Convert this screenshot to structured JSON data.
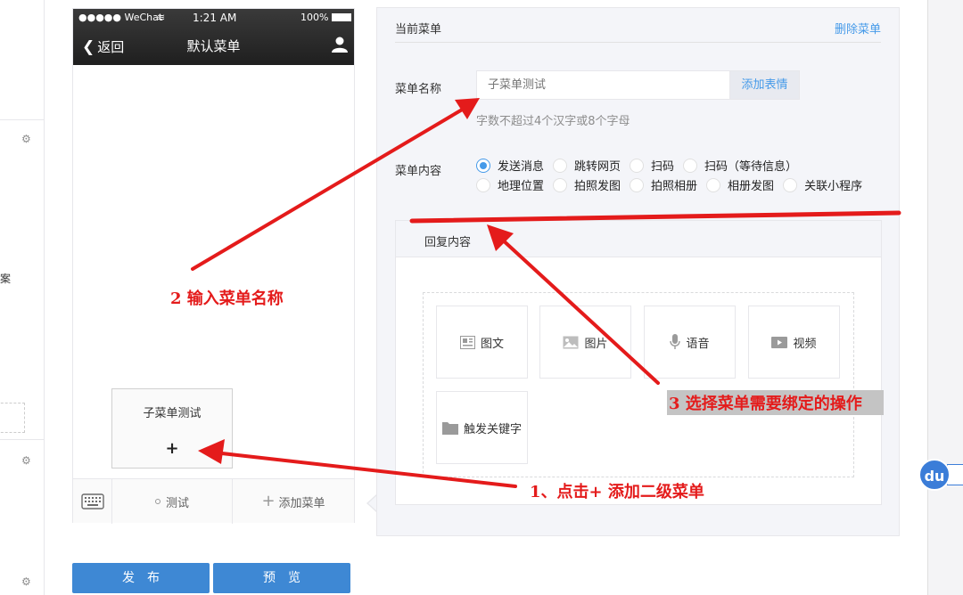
{
  "left_strip": {
    "cut_char": "案"
  },
  "phone": {
    "status_carrier": "●●●●● WeChat",
    "status_time": "1:21 AM",
    "status_battery": "100%",
    "back_label": "返回",
    "title": "默认菜单",
    "submenu_name": "子菜单测试",
    "submenu_add": "+",
    "bottom_menu": [
      {
        "label": "测试"
      },
      {
        "label": "添加菜单"
      }
    ]
  },
  "editor": {
    "title": "当前菜单",
    "delete_label": "删除菜单",
    "name_label": "菜单名称",
    "name_value": "子菜单测试",
    "emoji_button": "添加表情",
    "hint": "字数不超过4个汉字或8个字母",
    "content_label": "菜单内容",
    "options_row1": [
      {
        "label": "发送消息",
        "selected": true
      },
      {
        "label": "跳转网页",
        "selected": false
      },
      {
        "label": "扫码",
        "selected": false
      },
      {
        "label": "扫码（等待信息）",
        "selected": false
      }
    ],
    "options_row2": [
      {
        "label": "地理位置",
        "selected": false
      },
      {
        "label": "拍照发图",
        "selected": false
      },
      {
        "label": "拍照相册",
        "selected": false
      },
      {
        "label": "相册发图",
        "selected": false
      },
      {
        "label": "关联小程序",
        "selected": false
      }
    ],
    "reply_tab": "回复内容",
    "tiles": [
      {
        "label": "图文",
        "icon": "news-icon"
      },
      {
        "label": "图片",
        "icon": "image-icon"
      },
      {
        "label": "语音",
        "icon": "microphone-icon"
      },
      {
        "label": "视频",
        "icon": "video-icon"
      },
      {
        "label": "触发关键字",
        "icon": "folder-icon"
      }
    ]
  },
  "buttons": {
    "publish": "发布",
    "preview": "预览"
  },
  "annotations": {
    "step1": "1、点击+ 添加二级菜单",
    "step2": "2 输入菜单名称",
    "step3": "3 选择菜单需要绑定的操作",
    "color": "#e41b1b"
  },
  "badge": {
    "label": "du"
  },
  "colors": {
    "accent": "#459ae9",
    "button": "#3e88d4",
    "annotation": "#e41b1b"
  }
}
